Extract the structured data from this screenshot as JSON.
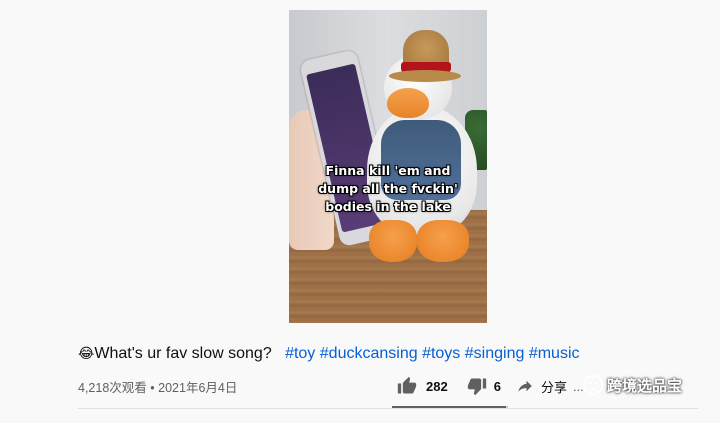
{
  "video": {
    "caption_lines": [
      "Finna kill 'em and",
      "dump all the fvckin'",
      "bodies in the lake"
    ]
  },
  "title": {
    "emoji": "😂",
    "text": "What's ur fav slow song?",
    "hashtags": [
      "#toy",
      "#duckcansing",
      "#toys",
      "#singing",
      "#music"
    ]
  },
  "meta": {
    "views": "4,218次观看",
    "separator": "•",
    "date": "2021年6月4日"
  },
  "actions": {
    "likes": "282",
    "dislikes": "6",
    "share_label": "分享",
    "more_label": "...",
    "like_ratio": 0.979
  },
  "watermark": {
    "text": "跨境选品宝"
  },
  "icons": {
    "like": "thumbs-up-icon",
    "dislike": "thumbs-down-icon",
    "share": "share-arrow-icon",
    "watermark_logo": "wechat-logo-icon"
  },
  "colors": {
    "hashtag": "#065fd4",
    "meta_text": "#606060",
    "background": "#f9f9f9"
  }
}
